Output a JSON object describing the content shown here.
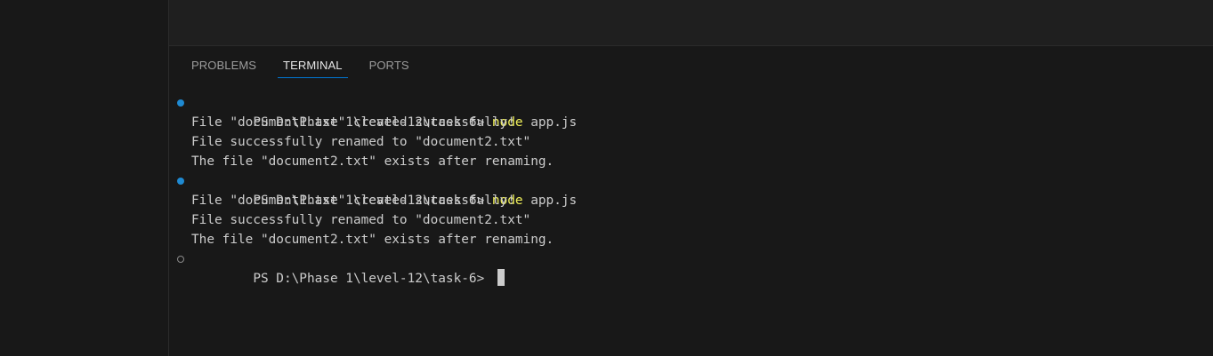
{
  "panel": {
    "tabs": [
      {
        "label": "PROBLEMS",
        "active": false
      },
      {
        "label": "TERMINAL",
        "active": true
      },
      {
        "label": "PORTS",
        "active": false
      }
    ]
  },
  "terminal": {
    "prompt": "PS D:\\Phase 1\\level-12\\task-6> ",
    "runs": [
      {
        "status": "success",
        "command": "node",
        "args": " app.js",
        "output": [
          "File \"document1.txt\" created successfully!",
          "File successfully renamed to \"document2.txt\"",
          "The file \"document2.txt\" exists after renaming."
        ]
      },
      {
        "status": "success",
        "command": "node",
        "args": " app.js",
        "output": [
          "File \"document1.txt\" created successfully!",
          "File successfully renamed to \"document2.txt\"",
          "The file \"document2.txt\" exists after renaming."
        ]
      }
    ],
    "current_prompt_status": "pending"
  },
  "colors": {
    "background": "#181818",
    "text": "#cccccc",
    "command": "#f1f15a",
    "active_tab_underline": "#0078d4",
    "success_dot": "#1f8ad2"
  }
}
